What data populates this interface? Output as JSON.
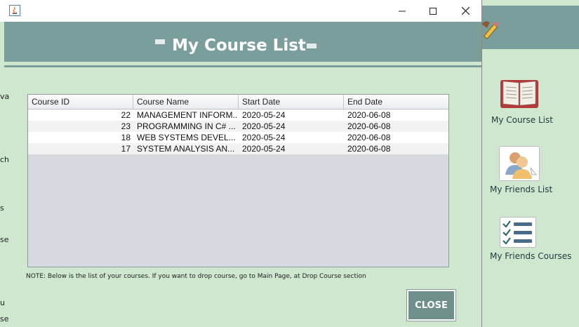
{
  "dialog": {
    "title": "My Course List",
    "window_controls": {
      "minimize": "—",
      "maximize": "☐",
      "close": "✕"
    },
    "table": {
      "columns": [
        "Course ID",
        "Course Name",
        "Start Date",
        "End Date"
      ],
      "rows": [
        {
          "id": "22",
          "name": "MANAGEMENT INFORM...",
          "start": "2020-05-24",
          "end": "2020-06-08"
        },
        {
          "id": "23",
          "name": "PROGRAMMING IN C# ...",
          "start": "2020-05-24",
          "end": "2020-06-08"
        },
        {
          "id": "18",
          "name": "WEB SYSTEMS DEVEL...",
          "start": "2020-05-24",
          "end": "2020-06-08"
        },
        {
          "id": "17",
          "name": "SYSTEM ANALYSIS AN...",
          "start": "2020-05-24",
          "end": "2020-06-08"
        }
      ]
    },
    "note": "NOTE: Below is the list of your courses. If you want to drop course, go to Main Page, at Drop Course section",
    "close_label": "CLOSE"
  },
  "sidebar": {
    "items": [
      {
        "label": "My Course List",
        "icon": "book-icon"
      },
      {
        "label": "My Friends List",
        "icon": "friends-icon"
      },
      {
        "label": "My Friends Courses",
        "icon": "checklist-icon"
      }
    ]
  },
  "background_edge_text": [
    "va",
    "ch",
    "s",
    "se",
    "u",
    "se"
  ],
  "colors": {
    "header": "#7a9e9c",
    "panel": "#cfe6cf",
    "close_button": "#6f8f8b"
  }
}
